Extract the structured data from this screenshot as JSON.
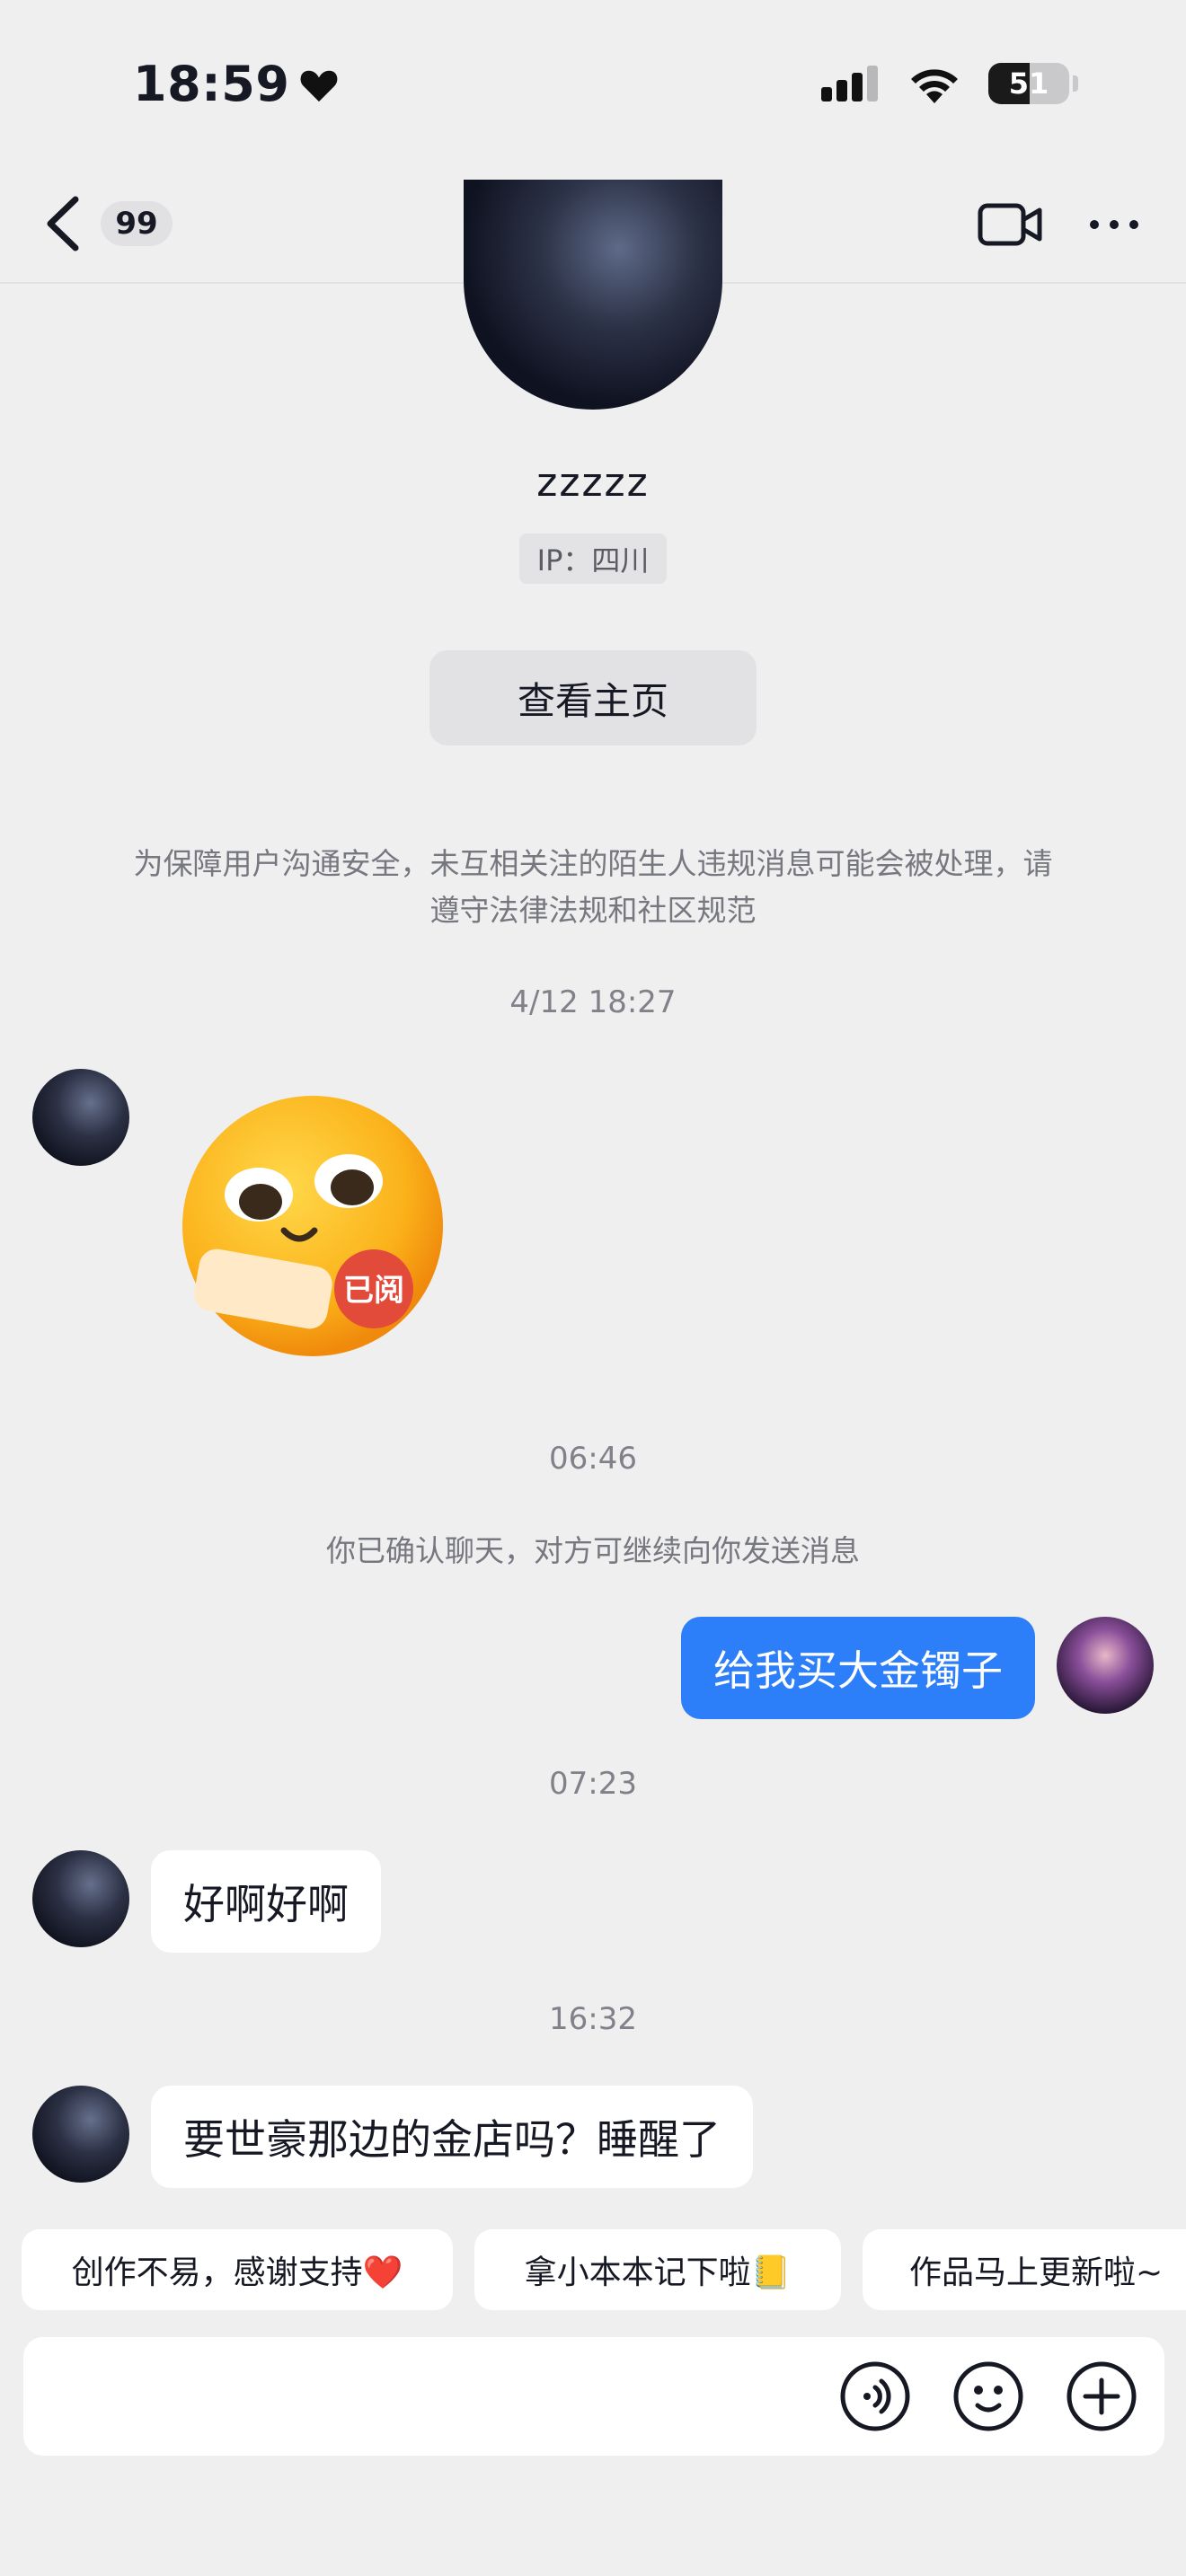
{
  "status_bar": {
    "time": "18:59",
    "battery": "51",
    "battery_level": 0.51
  },
  "nav": {
    "back_badge": "99"
  },
  "profile": {
    "username": "zzzzz",
    "ip": "IP：四川",
    "homepage_button": "查看主页"
  },
  "notice": "为保障用户沟通安全，未互相关注的陌生人违规消息可能会被处理，请遵守法律法规和社区规范",
  "messages": {
    "time_1": "4/12 18:27",
    "sticker_text": "已阅",
    "time_2": "06:46",
    "system_msg": "你已确认聊天，对方可继续向你发送消息",
    "me_msg": "给我买大金镯子",
    "time_3": "07:23",
    "reply_1": "好啊好啊",
    "time_4": "16:32",
    "reply_2": "要世豪那边的金店吗？睡醒了"
  },
  "quick_replies": [
    "创作不易，感谢支持❤️",
    "拿小本本记下啦📒",
    "作品马上更新啦~"
  ],
  "input_icons": [
    "voice-icon",
    "emoji-icon",
    "plus-icon"
  ]
}
